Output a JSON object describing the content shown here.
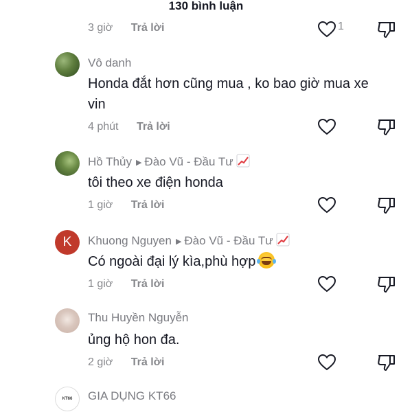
{
  "header": {
    "title": "130 bình luận"
  },
  "cut_row": {
    "time": "3 giờ",
    "reply": "Trả lời",
    "likes": "1"
  },
  "comments": [
    {
      "name": "Vô danh",
      "reply_to": "",
      "text": "Honda đắt hơn cũng mua , ko bao giờ mua xe vin",
      "time": "4 phút",
      "reply": "Trả lời",
      "avatar": "green-leaf-avatar"
    },
    {
      "name": "Hồ Thủy",
      "reply_to": "Đào Vũ - Đầu Tư",
      "text": "tôi theo xe điện honda",
      "time": "1 giờ",
      "reply": "Trả lời",
      "avatar": "green-leaf-avatar"
    },
    {
      "name": "Khuong Nguyen",
      "reply_to": "Đào Vũ - Đầu Tư",
      "text": "Có ngoài đại lý kìa,phù hợp",
      "time": "1 giờ",
      "reply": "Trả lời",
      "avatar_letter": "K",
      "emoji": "laughing-tears-emoji"
    },
    {
      "name": "Thu Huyền Nguyễn",
      "reply_to": "",
      "text": "ủng hộ hon đa.",
      "time": "2 giờ",
      "reply": "Trả lời",
      "avatar": "photo-avatar"
    },
    {
      "name": "GIA DỤNG KT66",
      "avatar_text": "KT66",
      "avatar": "logo-avatar"
    }
  ],
  "icons": {
    "like": "heart-outline-icon",
    "dislike": "thumbs-down-outline-icon",
    "chart": "chart-increasing-icon"
  },
  "colors": {
    "text": "#161823",
    "muted": "#86878b",
    "avatar_k": "#c0392b"
  }
}
